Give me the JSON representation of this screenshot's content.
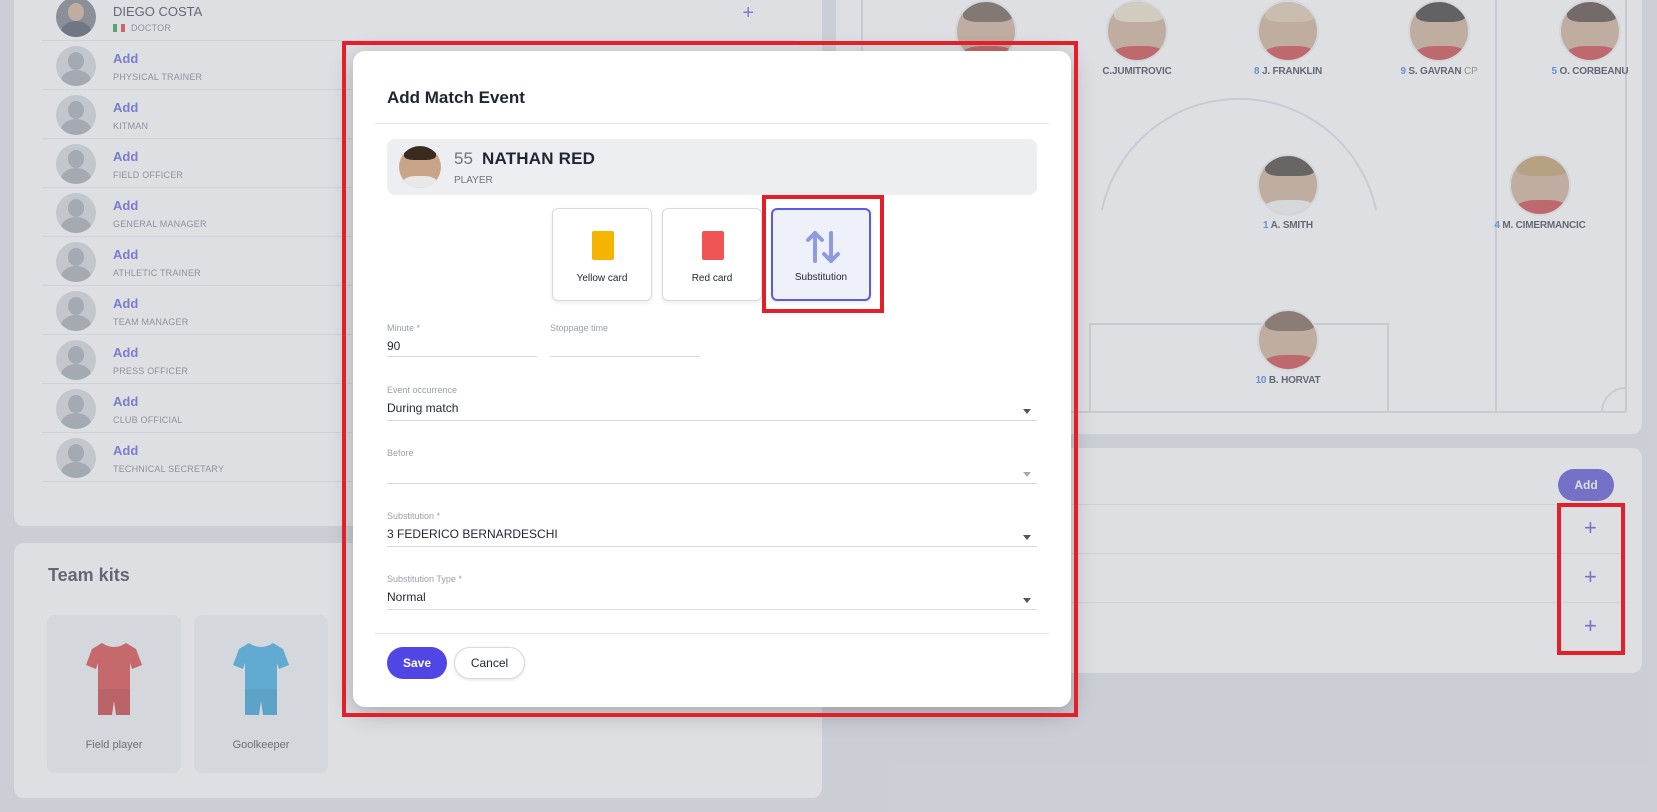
{
  "staff": {
    "rows": [
      {
        "name": "DIEGO COSTA",
        "role": "DOCTOR",
        "type": "person"
      },
      {
        "name": "Add",
        "role": "PHYSICAL TRAINER",
        "type": "add"
      },
      {
        "name": "Add",
        "role": "KITMAN",
        "type": "add"
      },
      {
        "name": "Add",
        "role": "FIELD OFFICER",
        "type": "add"
      },
      {
        "name": "Add",
        "role": "GENERAL MANAGER",
        "type": "add"
      },
      {
        "name": "Add",
        "role": "ATHLETIC TRAINER",
        "type": "add"
      },
      {
        "name": "Add",
        "role": "TEAM MANAGER",
        "type": "add"
      },
      {
        "name": "Add",
        "role": "PRESS OFFICER",
        "type": "add"
      },
      {
        "name": "Add",
        "role": "CLUB OFFICIAL",
        "type": "add"
      },
      {
        "name": "Add",
        "role": "TECHNICAL SECRETARY",
        "type": "add"
      }
    ],
    "plus_symbol": "+"
  },
  "kits": {
    "title": "Team kits",
    "items": [
      {
        "label": "Field player",
        "color": "#d62828"
      },
      {
        "label": "Goolkeeper",
        "color": "#1ea0e0"
      }
    ]
  },
  "pitch": {
    "players": [
      {
        "num": "",
        "name": "",
        "extra": ""
      },
      {
        "num": "",
        "name": "C.JUMITROVIC",
        "extra": ""
      },
      {
        "num": "8",
        "name": "J. FRANKLIN",
        "extra": ""
      },
      {
        "num": "9",
        "name": "S. GAVRAN",
        "extra": "CP"
      },
      {
        "num": "5",
        "name": "O. CORBEANU",
        "extra": ""
      },
      {
        "num": "1",
        "name": "A. SMITH",
        "extra": ""
      },
      {
        "num": "4",
        "name": "M. CIMERMANCIC",
        "extra": ""
      },
      {
        "num": "10",
        "name": "B. HORVAT",
        "extra": ""
      }
    ]
  },
  "subs": {
    "add_label": "Add",
    "plus_symbol": "+"
  },
  "modal": {
    "title": "Add Match Event",
    "player": {
      "number": "55",
      "name": "NATHAN RED",
      "role": "PLAYER"
    },
    "event_types": [
      {
        "label": "Yellow card",
        "color": "#f4b400"
      },
      {
        "label": "Red card",
        "color": "#f05555"
      },
      {
        "label": "Substitution",
        "color": "#8f9be0"
      }
    ],
    "fields": {
      "minute": {
        "label": "Minute *",
        "value": "90"
      },
      "stoppage": {
        "label": "Stoppage time",
        "value": ""
      },
      "occurrence": {
        "label": "Event occurrence",
        "value": "During match"
      },
      "before": {
        "label": "Before",
        "value": ""
      },
      "substitution": {
        "label": "Substitution *",
        "value": "3 FEDERICO BERNARDESCHI"
      },
      "sub_type": {
        "label": "Substitution Type *",
        "value": "Normal"
      }
    },
    "save_label": "Save",
    "cancel_label": "Cancel"
  }
}
